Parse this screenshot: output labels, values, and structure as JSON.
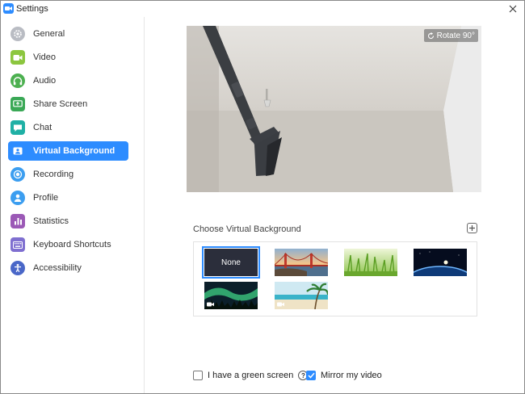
{
  "window": {
    "title": "Settings"
  },
  "sidebar": {
    "items": [
      {
        "label": "General",
        "icon": "gear-icon",
        "color": "#b9bcc3",
        "active": false
      },
      {
        "label": "Video",
        "icon": "video-camera-icon",
        "color": "#8cc63f",
        "active": false
      },
      {
        "label": "Audio",
        "icon": "headphones-icon",
        "color": "#4cb050",
        "active": false
      },
      {
        "label": "Share Screen",
        "icon": "share-screen-icon",
        "color": "#3aa856",
        "active": false
      },
      {
        "label": "Chat",
        "icon": "chat-bubble-icon",
        "color": "#1fb0a5",
        "active": false
      },
      {
        "label": "Virtual Background",
        "icon": "person-badge-icon",
        "color": "#2d8cff",
        "active": true
      },
      {
        "label": "Recording",
        "icon": "record-icon",
        "color": "#3c9ef0",
        "active": false
      },
      {
        "label": "Profile",
        "icon": "person-icon",
        "color": "#3c9ef0",
        "active": false
      },
      {
        "label": "Statistics",
        "icon": "bar-chart-icon",
        "color": "#9b59b6",
        "active": false
      },
      {
        "label": "Keyboard Shortcuts",
        "icon": "keyboard-icon",
        "color": "#7f6fd0",
        "active": false
      },
      {
        "label": "Accessibility",
        "icon": "accessibility-icon",
        "color": "#4a67c8",
        "active": false
      }
    ]
  },
  "preview": {
    "rotate_label": "Rotate 90°"
  },
  "backgrounds": {
    "heading": "Choose Virtual Background",
    "none_label": "None",
    "items": [
      {
        "name": "golden-gate-bridge",
        "type": "image",
        "selected": false
      },
      {
        "name": "grass",
        "type": "image",
        "selected": false
      },
      {
        "name": "earth-from-space",
        "type": "image",
        "selected": false
      },
      {
        "name": "aurora",
        "type": "video",
        "selected": false
      },
      {
        "name": "beach",
        "type": "video",
        "selected": false
      }
    ]
  },
  "options": {
    "green_screen": {
      "label": "I have a green screen",
      "checked": false
    },
    "mirror": {
      "label": "Mirror my video",
      "checked": true
    }
  },
  "colors": {
    "accent": "#2d8cff"
  }
}
